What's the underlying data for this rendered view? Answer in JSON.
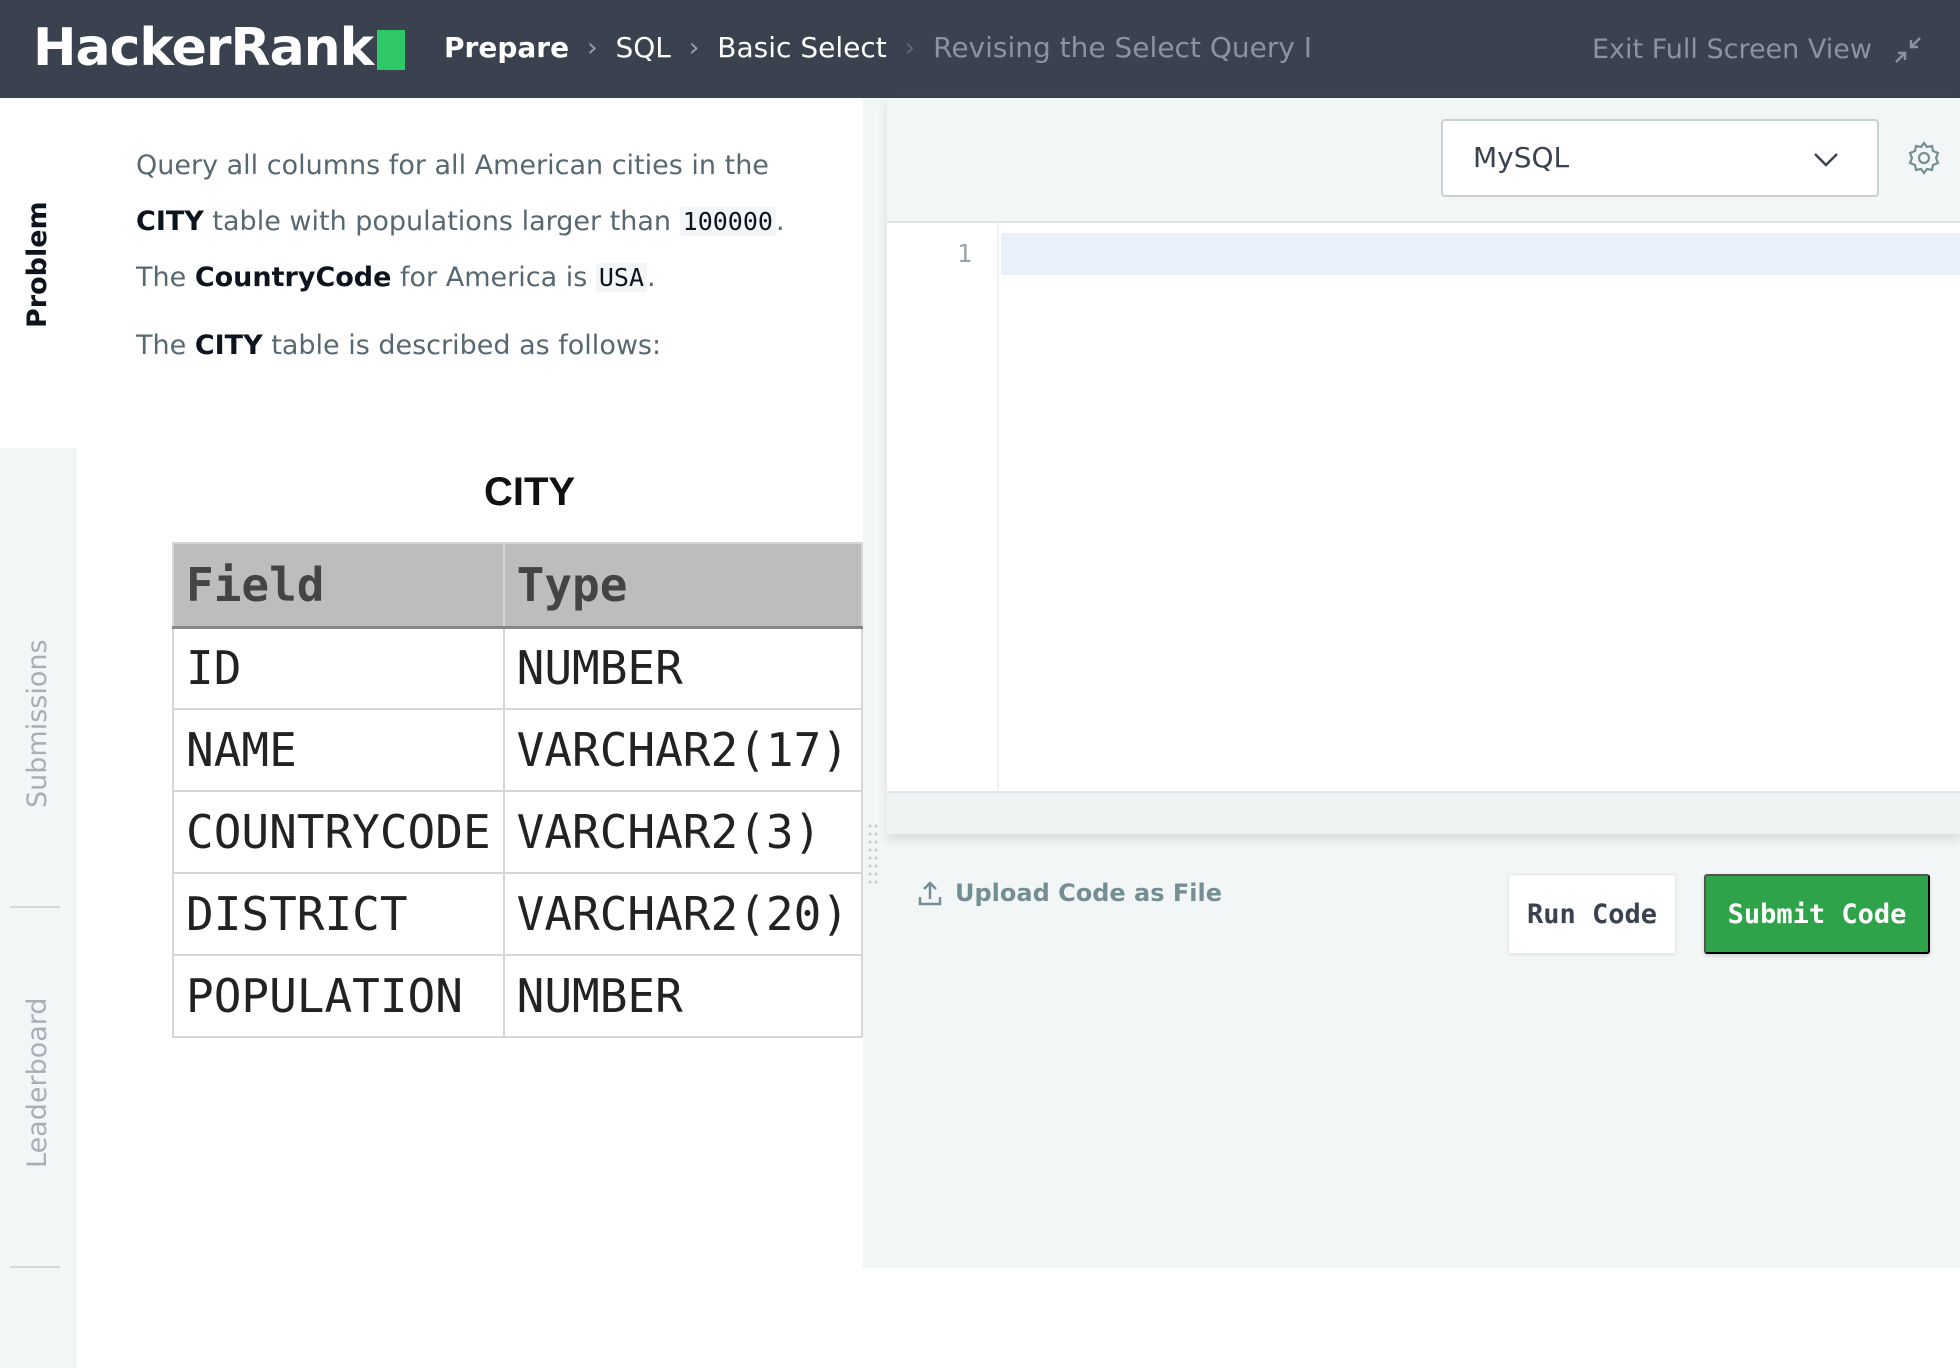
{
  "header": {
    "logo_text": "HackerRank",
    "logo_color": "#2ec866",
    "breadcrumbs": [
      "Prepare",
      "SQL",
      "Basic Select",
      "Revising the Select Query I"
    ],
    "exit_label": "Exit Full Screen View",
    "exit_icon": "minimize-arrows-icon",
    "background": "#39424e"
  },
  "side_tabs": {
    "problem": "Problem",
    "submissions": "Submissions",
    "leaderboard": "Leaderboard"
  },
  "problem": {
    "line1": "Query all columns for all American cities in the",
    "line2_bold": "CITY",
    "line2_text": " table with populations larger than ",
    "line2_code": "100000",
    "line2_end": ".",
    "line3_pre": "The ",
    "line3_bold": "CountryCode",
    "line3_mid": " for America is ",
    "line3_code": "USA",
    "line3_end": ".",
    "line4_pre": "The ",
    "line4_bold": "CITY",
    "line4_text": " table is described as follows:",
    "table_title": "CITY",
    "table_headers": [
      "Field",
      "Type"
    ],
    "table_rows": [
      [
        "ID",
        "NUMBER"
      ],
      [
        "NAME",
        "VARCHAR2(17)"
      ],
      [
        "COUNTRYCODE",
        "VARCHAR2(3)"
      ],
      [
        "DISTRICT",
        "VARCHAR2(20)"
      ],
      [
        "POPULATION",
        "NUMBER"
      ]
    ]
  },
  "editor": {
    "language": "MySQL",
    "line_numbers": [
      "1"
    ],
    "settings_icon": "gear-icon",
    "upload_label": "Upload Code as File",
    "upload_icon": "upload-icon",
    "run_label": "Run Code",
    "submit_label": "Submit Code",
    "submit_color": "#2fa34a"
  }
}
